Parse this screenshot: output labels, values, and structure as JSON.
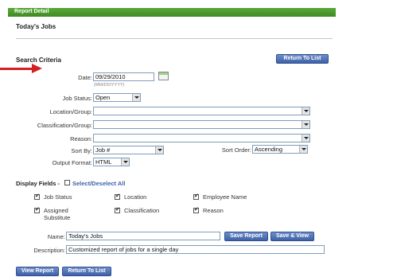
{
  "header": {
    "title": "Report Detail"
  },
  "page": {
    "title": "Today's Jobs"
  },
  "search_criteria": {
    "title": "Search Criteria",
    "return_button": "Return To List",
    "date": {
      "label": "Date:",
      "value": "09/29/2010",
      "hint": "(MM/DD/YYYY)"
    },
    "job_status": {
      "label": "Job Status:",
      "value": "Open"
    },
    "location_group": {
      "label": "Location/Group:",
      "value": ""
    },
    "classification_group": {
      "label": "Classification/Group:",
      "value": ""
    },
    "reason": {
      "label": "Reason:",
      "value": ""
    },
    "sort_by": {
      "label": "Sort By:",
      "value": "Job #"
    },
    "sort_order": {
      "label": "Sort Order:",
      "value": "Ascending"
    },
    "output_format": {
      "label": "Output Format:",
      "value": "HTML"
    }
  },
  "display_fields": {
    "label": "Display Fields -",
    "select_all": "Select/Deselect All",
    "items": [
      {
        "label": "Job Status",
        "checked": true
      },
      {
        "label": "Location",
        "checked": true
      },
      {
        "label": "Employee Name",
        "checked": true
      },
      {
        "label": "Assigned Substitute",
        "checked": true
      },
      {
        "label": "Classification",
        "checked": true
      },
      {
        "label": "Reason",
        "checked": true
      }
    ]
  },
  "report": {
    "name_label": "Name:",
    "name_value": "Today's Jobs",
    "description_label": "Description:",
    "description_value": "Customized report of jobs for a single day",
    "save_report": "Save Report",
    "save_view": "Save & View"
  },
  "footer": {
    "view_report": "View Report",
    "return_to_list": "Return To List"
  },
  "colors": {
    "header": "#3f8a22",
    "button": "#3e61a8",
    "arrow": "#d42020"
  }
}
